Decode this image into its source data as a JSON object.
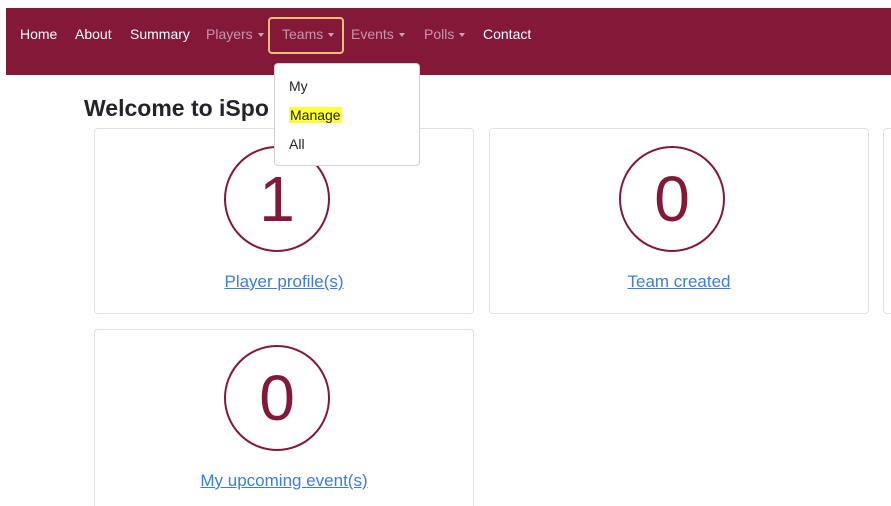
{
  "nav": {
    "items": [
      {
        "label": "Home",
        "dropdown": false
      },
      {
        "label": "About",
        "dropdown": false
      },
      {
        "label": "Summary",
        "dropdown": false
      },
      {
        "label": "Players",
        "dropdown": true
      },
      {
        "label": "Teams",
        "dropdown": true
      },
      {
        "label": "Events",
        "dropdown": true
      },
      {
        "label": "Polls",
        "dropdown": true
      },
      {
        "label": "Contact",
        "dropdown": false
      }
    ],
    "active_dropdown": "Teams"
  },
  "teams_menu": {
    "items": [
      "My",
      "Manage",
      "All"
    ],
    "highlighted": "Manage"
  },
  "page": {
    "title": "Welcome to iSpo"
  },
  "cards": [
    {
      "count": "1",
      "link": "Player profile(s)"
    },
    {
      "count": "0",
      "link": "Team created"
    },
    {
      "count": "0",
      "link": "My upcoming event(s)"
    }
  ],
  "colors": {
    "brand": "#831838",
    "link": "#3b7de0",
    "annotation_box": "#f4bd74",
    "text_highlight": "#ffff35"
  }
}
